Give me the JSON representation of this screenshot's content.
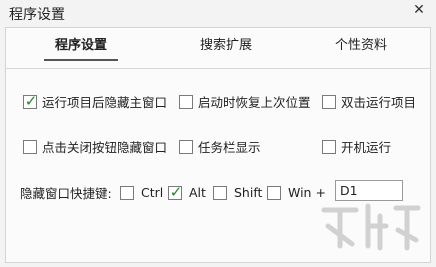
{
  "window": {
    "title": "程序设置"
  },
  "tabs": [
    {
      "label": "程序设置"
    },
    {
      "label": "搜索扩展"
    },
    {
      "label": "个性资料"
    }
  ],
  "options": {
    "run_hide": {
      "label": "运行项目后隐藏主窗口",
      "checked": true
    },
    "restore_pos": {
      "label": "启动时恢复上次位置",
      "checked": false
    },
    "dblclick_run": {
      "label": "双击运行项目",
      "checked": false
    },
    "close_hide": {
      "label": "点击关闭按钮隐藏窗口",
      "checked": false
    },
    "taskbar": {
      "label": "任务栏显示",
      "checked": false
    },
    "autostart": {
      "label": "开机运行",
      "checked": false
    }
  },
  "hotkey": {
    "label": "隐藏窗口快捷键:",
    "ctrl": {
      "label": "Ctrl",
      "checked": false
    },
    "alt": {
      "label": "Alt",
      "checked": true
    },
    "shift": {
      "label": "Shift",
      "checked": false
    },
    "win": {
      "label": "Win +",
      "checked": false
    },
    "key_value": "D1"
  },
  "colors": {
    "check": "#1e8a2a"
  }
}
